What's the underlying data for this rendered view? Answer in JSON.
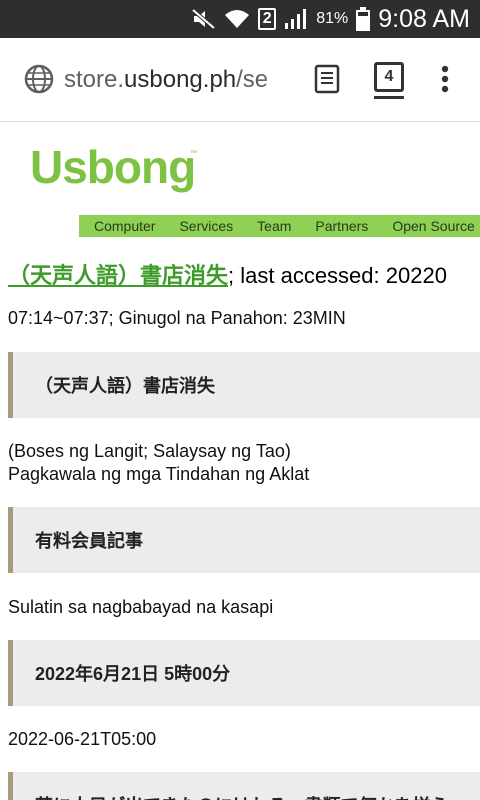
{
  "status_bar": {
    "sim_slot": "2",
    "battery_percent": "81%",
    "time": "9:08 AM",
    "icons": [
      "mute-icon",
      "wifi-icon",
      "sim-icon",
      "signal-icon",
      "battery-icon"
    ]
  },
  "browser": {
    "url_scheme": "",
    "url_host_prefix": "store.",
    "url_host": "usbong.ph",
    "url_path": "/se",
    "tab_count": "4"
  },
  "site": {
    "logo_text": "Usbong",
    "logo_trademark": "™",
    "brand_color": "#7dc242",
    "nav": [
      "Computer",
      "Services",
      "Team",
      "Partners",
      "Open Source"
    ]
  },
  "article": {
    "title_link": "（天声人語）書店消失",
    "title_rest": "; last accessed: 20220",
    "time_line": "07:14~07:37; Ginugol na Panahon: 23MIN",
    "sections": [
      {
        "box": "（天声人語）書店消失",
        "text_lines": [
          "(Boses ng Langit; Salaysay ng Tao)",
          "Pagkawala ng mga Tindahan ng Aklat"
        ]
      },
      {
        "box": "有料会員記事",
        "text_lines": [
          "Sulatin sa nagbabayad na kasapi"
        ]
      },
      {
        "box": "2022年6月21日 5時00分",
        "text_lines": [
          "2022-06-21T05:00"
        ]
      },
      {
        "box": "芸に人目が出てきたのにはわる。書類で何かを揃え"
      }
    ]
  }
}
